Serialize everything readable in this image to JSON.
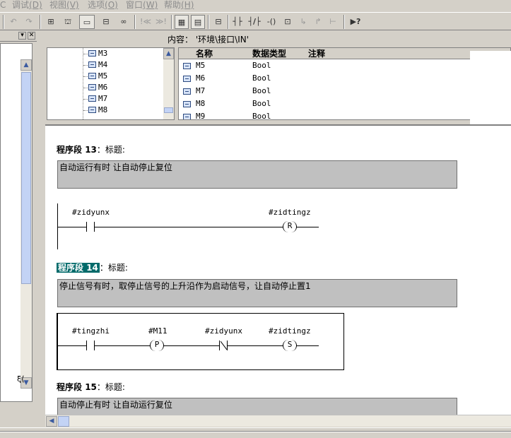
{
  "menu": [
    {
      "label": "C",
      "key": ""
    },
    {
      "label": "调试",
      "key": "(D)"
    },
    {
      "label": "视图",
      "key": "(V)"
    },
    {
      "label": "选项",
      "key": "(O)"
    },
    {
      "label": "窗口",
      "key": "(W)"
    },
    {
      "label": "帮助",
      "key": "(H)"
    }
  ],
  "toolbar": {
    "undo": "↶",
    "redo": "↷",
    "network": "⊞",
    "comment_btn": "▭",
    "overview": "⊟",
    "monitor": "👓",
    "prev_err": "!≪",
    "next_err": "≫!",
    "catalog": "▦",
    "details": "▤",
    "new_network": "⊟",
    "contact_no": "┤├",
    "contact_nc": "┤/├",
    "coil": "-()",
    "box": "⊡",
    "branch_open": "↳",
    "branch_close": "↱",
    "connect": "⊢",
    "help": "▶?"
  },
  "interface": {
    "header": "内容：  '环境\\接口\\IN'",
    "tree": [
      "M3",
      "M4",
      "M5",
      "M6",
      "M7",
      "M8"
    ],
    "columns": [
      "名称",
      "数据类型",
      "注释"
    ],
    "rows": [
      {
        "name": "M5",
        "type": "Bool"
      },
      {
        "name": "M6",
        "type": "Bool"
      },
      {
        "name": "M7",
        "type": "Bool"
      },
      {
        "name": "M8",
        "type": "Bool"
      },
      {
        "name": "M9",
        "type": "Bool"
      }
    ]
  },
  "networks": [
    {
      "label": "程序段",
      "number": "13",
      "title_label": "：标题:",
      "comment": "自动运行有时 让自动停止复位",
      "contact": "#zidyunx",
      "coil_var": "#zidtingz",
      "coil": "R"
    },
    {
      "label": "程序段",
      "number": "14",
      "title_label": "：标题:",
      "comment": "停止信号有时，取停止信号的上升沿作为启动信号，让自动停止置1",
      "contact1": "#tingzhi",
      "edge_var": "#M11",
      "edge": "P",
      "contact2": "#zidyunx",
      "coil_var": "#zidtingz",
      "coil": "S"
    },
    {
      "label": "程序段",
      "number": "15",
      "title_label": "：标题:",
      "comment": "自动停止有时 让自动运行复位"
    }
  ],
  "colors": {
    "selection": "#006a6a",
    "comment_bg": "#c0c0c0",
    "window_bg": "#d4d0c8"
  }
}
